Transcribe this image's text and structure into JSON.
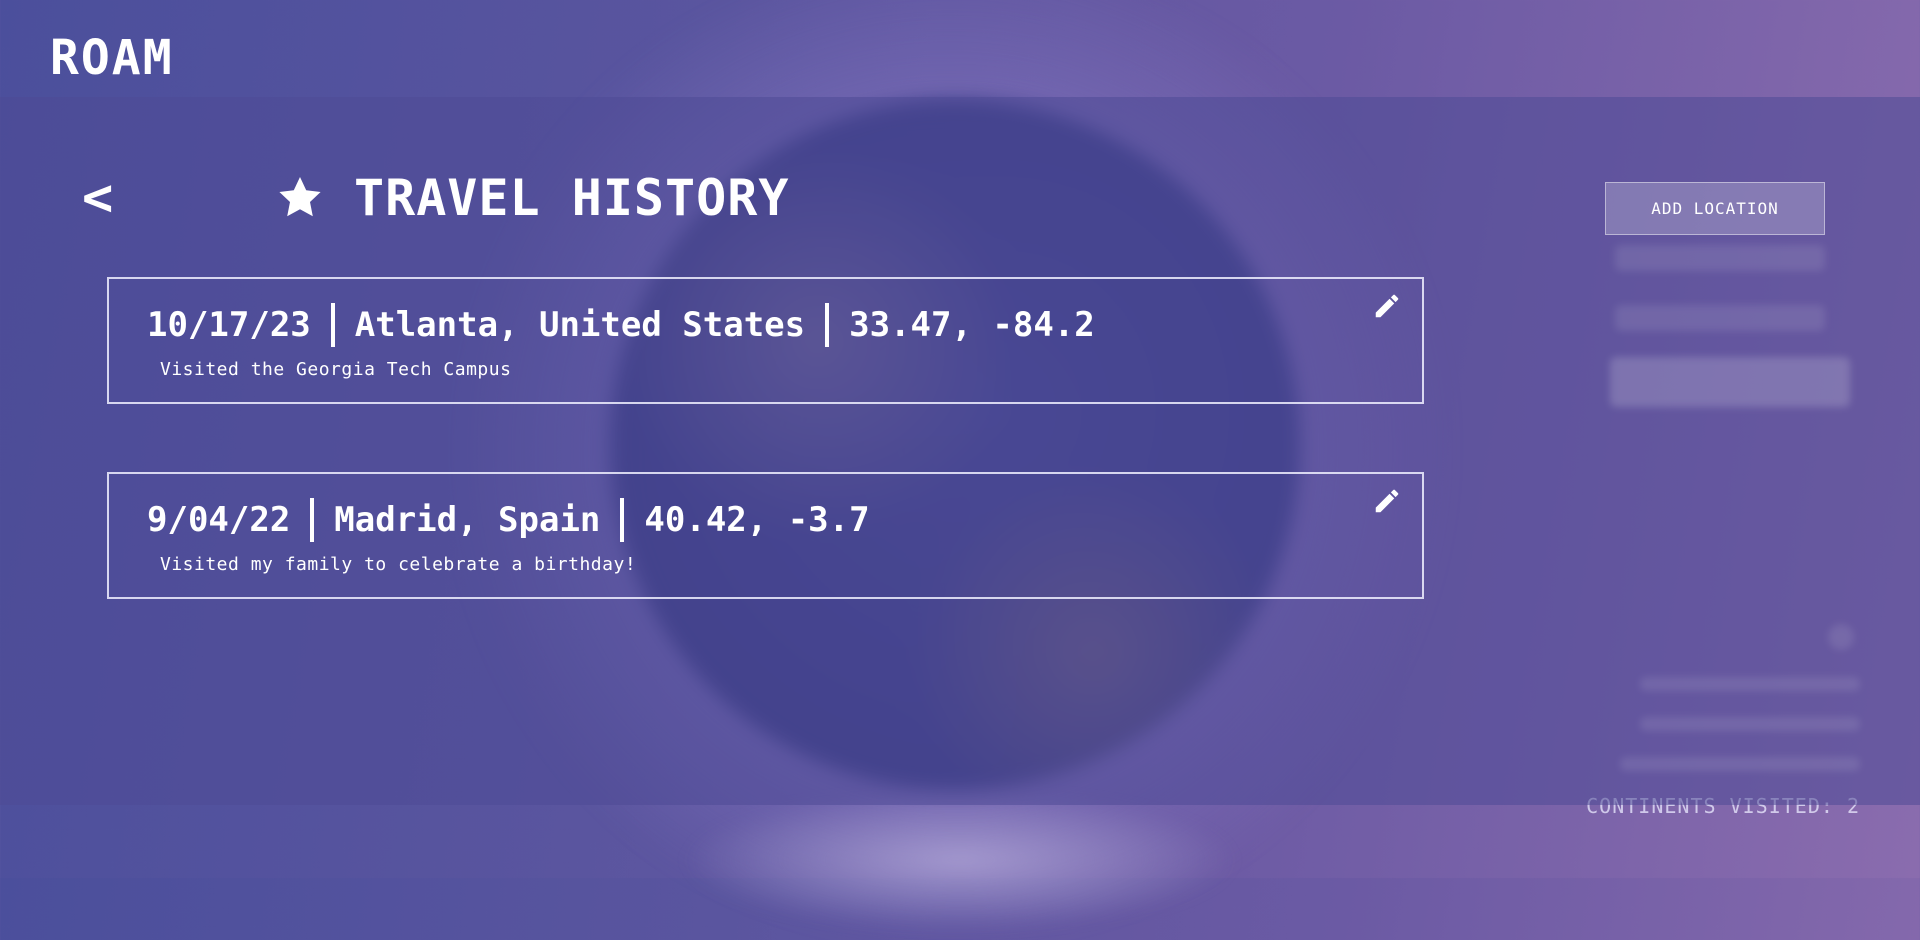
{
  "app": {
    "brand": "ROAM"
  },
  "header": {
    "back_label": "<",
    "title": "TRAVEL HISTORY",
    "add_location_label": "ADD LOCATION"
  },
  "entries": [
    {
      "date": "10/17/23",
      "place": "Atlanta, United States",
      "coords": "33.47, -84.2",
      "description": "Visited the Georgia Tech Campus"
    },
    {
      "date": "9/04/22",
      "place": "Madrid, Spain",
      "coords": "40.42, -3.7",
      "description": "Visited my family to celebrate a birthday!"
    }
  ],
  "stats": {
    "continents_label": "CONTINENTS VISITED: 2"
  },
  "icons": {
    "star": "star-icon",
    "edit": "pencil-icon",
    "back": "chevron-left"
  }
}
